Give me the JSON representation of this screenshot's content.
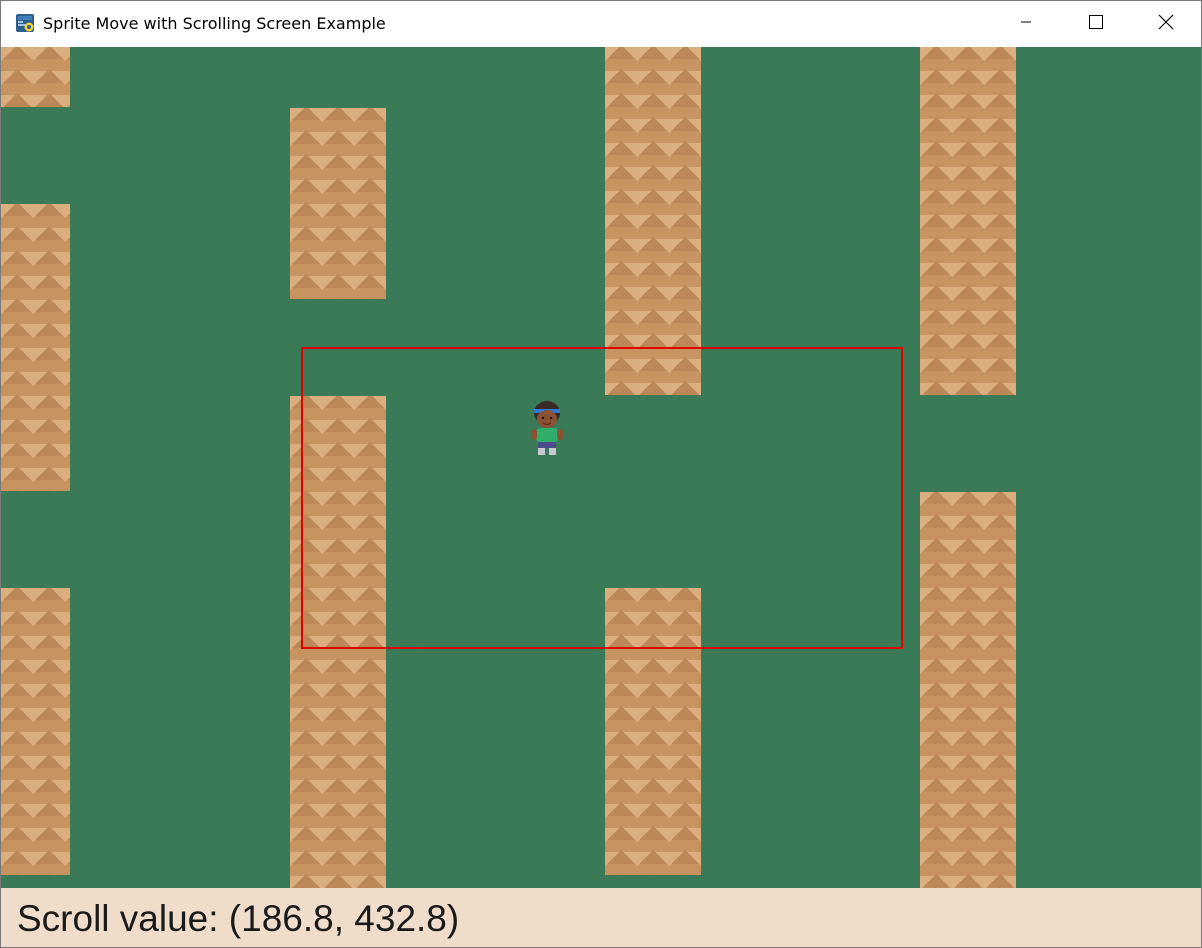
{
  "window": {
    "title": "Sprite Move with Scrolling Screen Example",
    "icons": {
      "app": "python-app-icon",
      "minimize": "minimize-icon",
      "maximize": "maximize-icon",
      "close": "close-icon"
    }
  },
  "game": {
    "background_color": "#3a7a57",
    "wall_color": "#c79361",
    "camera_box_color": "#e00000",
    "player_sprite": "player-character-icon"
  },
  "status": {
    "scroll_label": "Scroll value:",
    "scroll_x": "186.8",
    "scroll_y": "432.8"
  }
}
